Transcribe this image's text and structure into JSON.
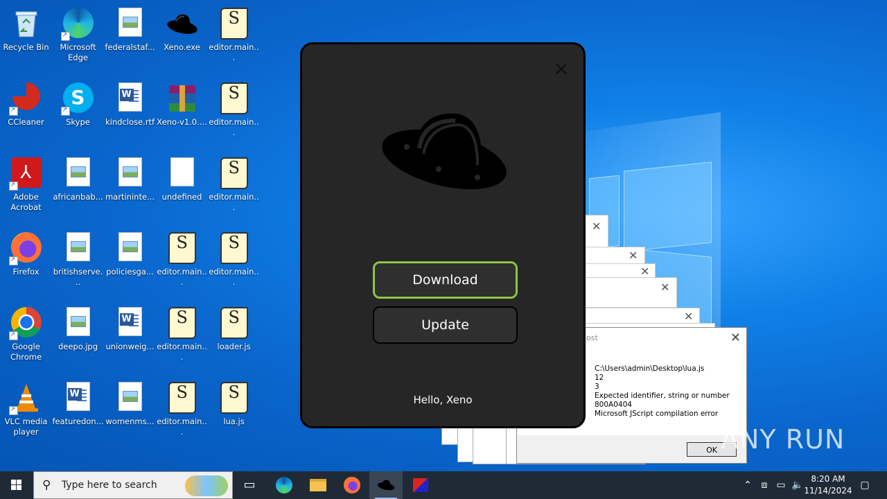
{
  "desktop": {
    "icons": [
      {
        "label": "Recycle Bin",
        "icon": "recycle-bin-icon"
      },
      {
        "label": "Microsoft Edge",
        "icon": "edge-icon"
      },
      {
        "label": "federalstaf...",
        "icon": "image-file-icon"
      },
      {
        "label": "Xeno.exe",
        "icon": "xeno-icon"
      },
      {
        "label": "editor.main...",
        "icon": "script-file-icon"
      },
      {
        "label": "CCleaner",
        "icon": "ccleaner-icon"
      },
      {
        "label": "Skype",
        "icon": "skype-icon"
      },
      {
        "label": "kindclose.rtf",
        "icon": "word-doc-icon"
      },
      {
        "label": "Xeno-v1.0....",
        "icon": "winrar-icon"
      },
      {
        "label": "editor.main...",
        "icon": "script-file-icon"
      },
      {
        "label": "Adobe Acrobat",
        "icon": "acrobat-icon"
      },
      {
        "label": "africanbab...",
        "icon": "image-file-icon"
      },
      {
        "label": "martininte...",
        "icon": "image-file-icon"
      },
      {
        "label": "undefined",
        "icon": "blank-file-icon"
      },
      {
        "label": "editor.main...",
        "icon": "script-file-icon"
      },
      {
        "label": "Firefox",
        "icon": "firefox-icon"
      },
      {
        "label": "britishserve...",
        "icon": "image-file-icon"
      },
      {
        "label": "policiesga...",
        "icon": "image-file-icon"
      },
      {
        "label": "editor.main...",
        "icon": "script-file-icon"
      },
      {
        "label": "editor.main...",
        "icon": "script-file-icon"
      },
      {
        "label": "Google Chrome",
        "icon": "chrome-icon"
      },
      {
        "label": "deepo.jpg",
        "icon": "image-file-icon"
      },
      {
        "label": "unionweig...",
        "icon": "word-doc-icon"
      },
      {
        "label": "editor.main...",
        "icon": "script-file-icon"
      },
      {
        "label": "loader.js",
        "icon": "script-file-icon"
      },
      {
        "label": "VLC media player",
        "icon": "vlc-icon"
      },
      {
        "label": "featuredon...",
        "icon": "word-doc-icon"
      },
      {
        "label": "womenms...",
        "icon": "image-file-icon"
      },
      {
        "label": "editor.main...",
        "icon": "script-file-icon"
      },
      {
        "label": "lua.js",
        "icon": "script-file-icon"
      }
    ]
  },
  "xeno_window": {
    "close_glyph": "✕",
    "download_label": "Download",
    "update_label": "Update",
    "greeting": "Hello, Xeno"
  },
  "error_dialog": {
    "title": "ost",
    "close_glyph": "✕",
    "message": "C:\\Users\\admin\\Desktop\\lua.js\n12\n3\nExpected identifier, string or number\n800A0404\nMicrosoft JScript compilation error",
    "ok_label": "OK"
  },
  "taskbar": {
    "search_placeholder": "Type here to search",
    "time": "8:20 AM",
    "date": "11/14/2024"
  },
  "watermark": "ANY RUN",
  "colors": {
    "download_border": "#8cc63f",
    "xeno_bg": "#262626"
  }
}
